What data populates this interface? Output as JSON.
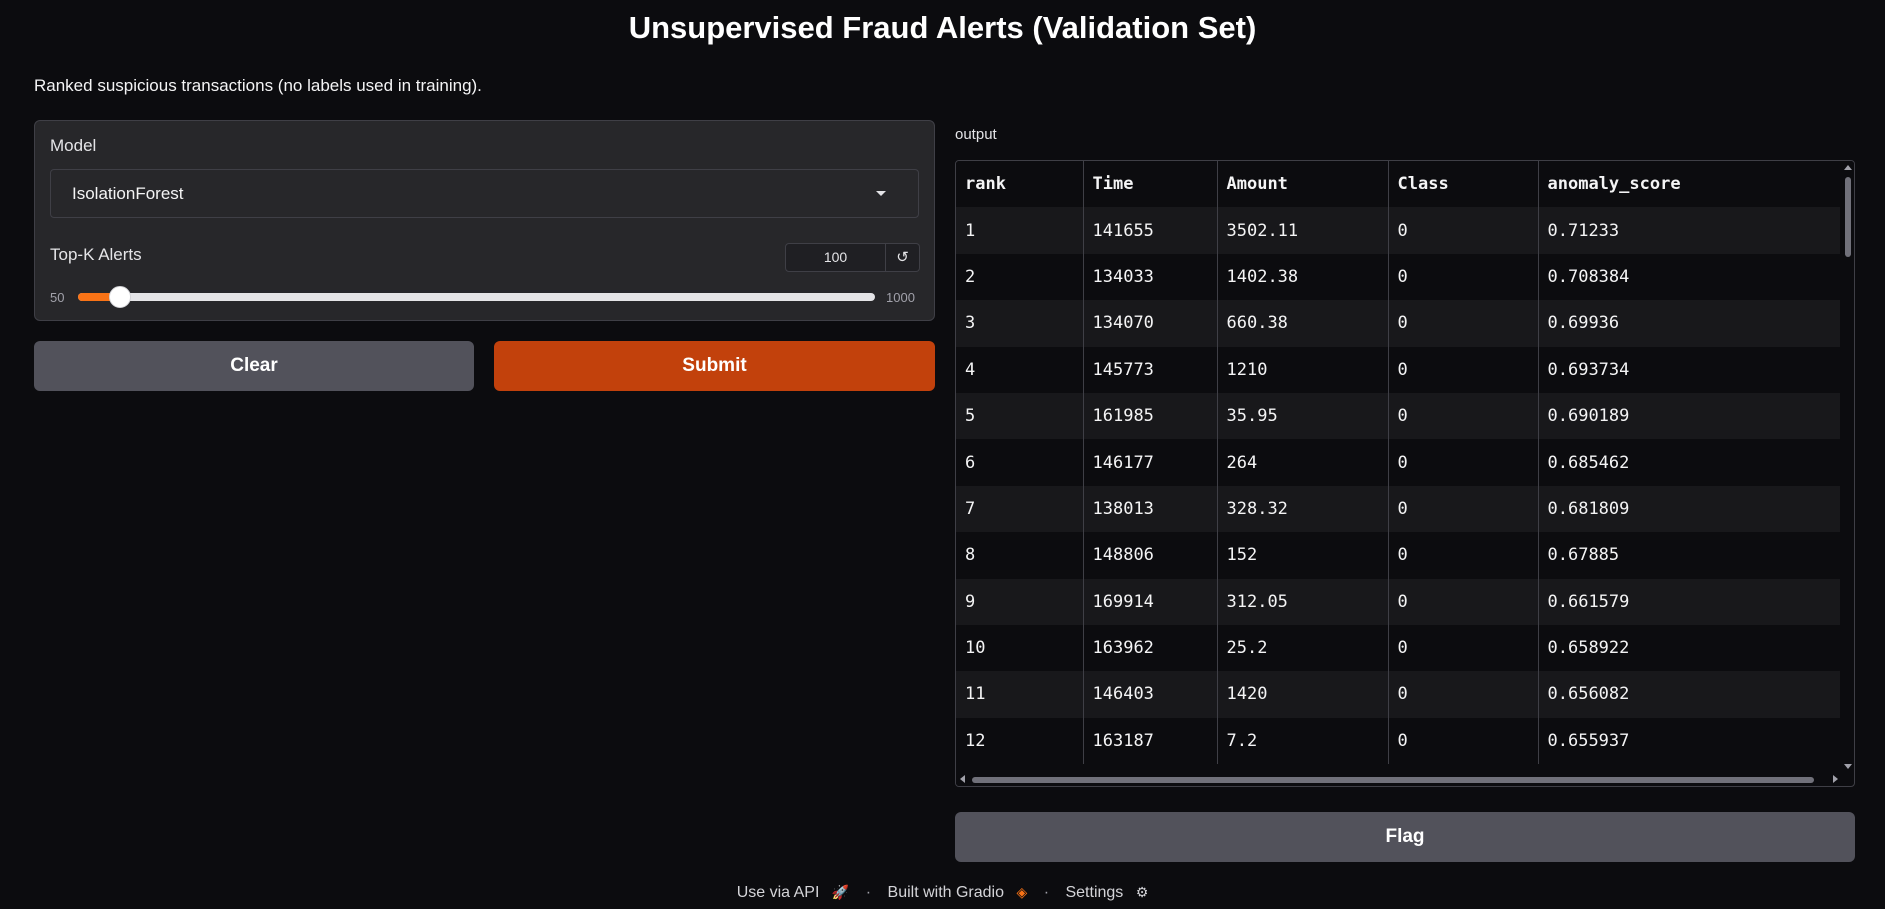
{
  "page": {
    "title": "Unsupervised Fraud Alerts (Validation Set)",
    "subtitle": "Ranked suspicious transactions (no labels used in training)."
  },
  "inputs": {
    "model_label": "Model",
    "model_value": "IsolationForest",
    "topk_label": "Top-K Alerts",
    "topk_value": "100",
    "reset_icon": "↺",
    "slider_min": "50",
    "slider_max": "1000",
    "slider_fraction": 0.0526
  },
  "buttons": {
    "clear": "Clear",
    "submit": "Submit",
    "flag": "Flag"
  },
  "output": {
    "label": "output",
    "columns": [
      "rank",
      "Time",
      "Amount",
      "Class",
      "anomaly_score"
    ],
    "rows": [
      [
        "1",
        "141655",
        "3502.11",
        "0",
        "0.71233"
      ],
      [
        "2",
        "134033",
        "1402.38",
        "0",
        "0.708384"
      ],
      [
        "3",
        "134070",
        "660.38",
        "0",
        "0.69936"
      ],
      [
        "4",
        "145773",
        "1210",
        "0",
        "0.693734"
      ],
      [
        "5",
        "161985",
        "35.95",
        "0",
        "0.690189"
      ],
      [
        "6",
        "146177",
        "264",
        "0",
        "0.685462"
      ],
      [
        "7",
        "138013",
        "328.32",
        "0",
        "0.681809"
      ],
      [
        "8",
        "148806",
        "152",
        "0",
        "0.67885"
      ],
      [
        "9",
        "169914",
        "312.05",
        "0",
        "0.661579"
      ],
      [
        "10",
        "163962",
        "25.2",
        "0",
        "0.658922"
      ],
      [
        "11",
        "146403",
        "1420",
        "0",
        "0.656082"
      ],
      [
        "12",
        "163187",
        "7.2",
        "0",
        "0.655937"
      ]
    ]
  },
  "footer": {
    "api": "Use via API",
    "built": "Built with Gradio",
    "settings": "Settings",
    "separator": "·",
    "rocket_icon": "🚀",
    "gradio_icon": "◈",
    "gear_icon": "⚙"
  },
  "colors": {
    "accent": "#c2410c",
    "slider_fill": "#f97316",
    "background": "#0c0c0f",
    "panel": "#27272a"
  }
}
